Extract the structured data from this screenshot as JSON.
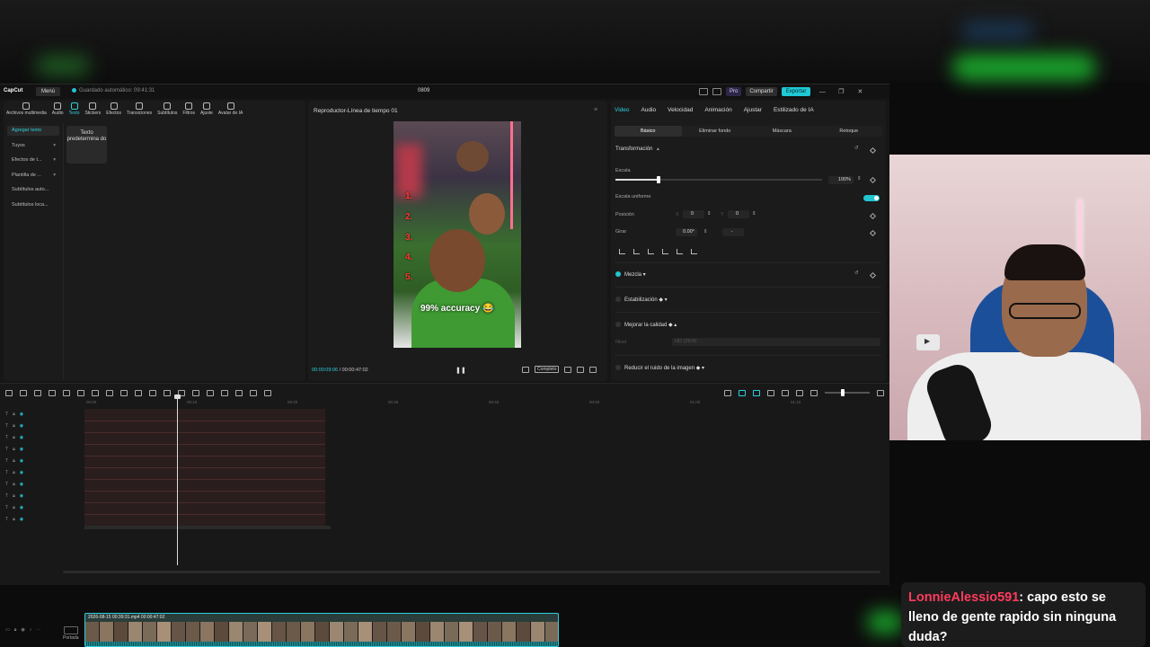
{
  "app": {
    "logo": "CapCut",
    "menu": "Menú",
    "autosave": "Guardado automático: 09:41:31",
    "project_title": "0809",
    "pro": "Pro",
    "share": "Compartir",
    "export": "Exportar"
  },
  "toolbar_tabs": [
    "Archivos multimedia",
    "Audio",
    "Texto",
    "Stickers",
    "Efectos",
    "Transiciones",
    "Subtítulos",
    "Filtros",
    "Ajuste",
    "Avatar de IA"
  ],
  "active_tab": "Texto",
  "text_sidebar": [
    "Agregar texto",
    "Tuyos",
    "Efectos de t...",
    "Plantilla de ...",
    "Subtítulos auto...",
    "Subtítulos loca..."
  ],
  "text_card": "Texto predetermina do",
  "player": {
    "title": "Reproductor-Línea de tiempo 01",
    "current_time": "00:00:09:06",
    "total_time": "00:00:47:02",
    "ratio_label": "Completo",
    "video_numbers": [
      "1.",
      "2.",
      "3.",
      "4.",
      "5."
    ],
    "caption": "99% accuracy 😂"
  },
  "inspector": {
    "tabs": [
      "Video",
      "Audio",
      "Velocidad",
      "Animación",
      "Ajustar",
      "Estilizado de IA"
    ],
    "sub_tabs": [
      "Básico",
      "Eliminar fondo",
      "Máscara",
      "Retoque"
    ],
    "transform": "Transformación",
    "scale_label": "Escala",
    "scale_value": "100%",
    "uniform_scale": "Escala uniforme",
    "position_label": "Posición",
    "pos_x_label": "X",
    "pos_x": "0",
    "pos_y_label": "Y",
    "pos_y": "0",
    "rotate_label": "Girar",
    "rotate_value": "0.00°",
    "rotate_dash": "-",
    "blend": "Mezcla",
    "stabilization": "Estabilización",
    "enhance": "Mejorar la calidad",
    "enhance_level_label": "Nivel",
    "enhance_level": "HD (2K/4)",
    "noise": "Reducir el ruido de la imagen"
  },
  "timeline": {
    "ruler": [
      "00:00",
      "00:10",
      "00:20",
      "00:30",
      "00:40",
      "00:50",
      "01:00",
      "01:10"
    ],
    "clip_label": "2026-08-15 00:39:31.mp4   00:00:47:02",
    "cover": "Portada"
  },
  "chat": {
    "user": "LonnieAlessio591",
    "message": ": capo esto se lleno de gente rapido sin ninguna duda?"
  }
}
